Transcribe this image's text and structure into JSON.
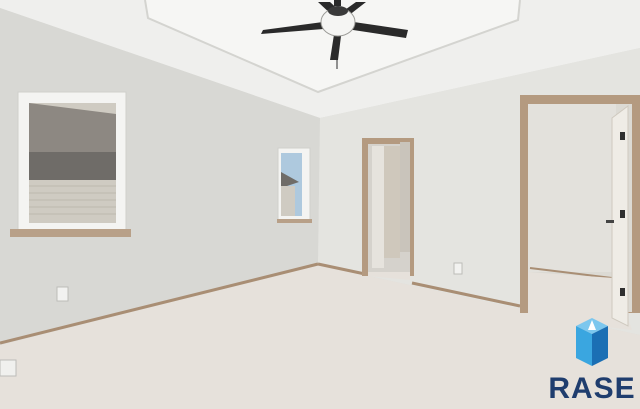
{
  "scene": {
    "description_free": true,
    "colors": {
      "ceiling": "#efefed",
      "tray_ceiling": "#f4f4f2",
      "left_wall": "#dadad6",
      "back_wall": "#e3e3df",
      "right_wall": "#e6e6e2",
      "carpet": "#e7e2dc",
      "baseboard": "#a98e74",
      "door_trim": "#b49a80",
      "window_frame": "#f4f4f2",
      "sky": "#aec9de",
      "roof": "#8d8882",
      "siding": "#cfcbc2",
      "fan_blade": "#2a2a2a",
      "fan_light": "#f5f5f3",
      "closet_interior": "#dcd9d3",
      "doorway_room": "#d8d6d0",
      "door_leaf": "#ece9e3"
    },
    "icons": [
      "ceiling-fan-icon",
      "outlet-icon",
      "floor-vent-icon"
    ]
  },
  "watermark": {
    "text": "RASE",
    "colors": {
      "cube_light": "#3aa6e0",
      "cube_dark": "#1b6fb4",
      "text": "#1f3d6e"
    }
  }
}
